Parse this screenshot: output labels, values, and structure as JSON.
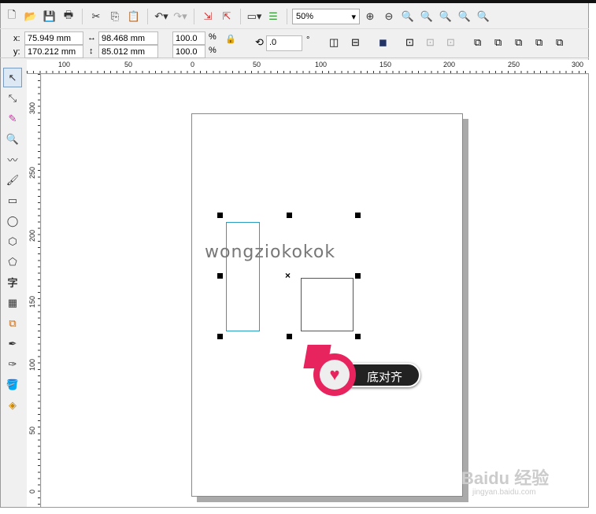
{
  "toolbar": {
    "icons": [
      "new-icon",
      "open-icon",
      "save-icon",
      "print-icon",
      "cut-icon",
      "copy-icon",
      "paste-icon",
      "undo-icon",
      "redo-icon",
      "import-icon",
      "export-icon",
      "publish-icon",
      "options-icon"
    ],
    "zoom_value": "50%",
    "zoom_icons": [
      "zoom-in-icon",
      "zoom-out-icon",
      "zoom-selected-icon",
      "zoom-all-icon",
      "zoom-page-icon",
      "zoom-width-icon",
      "zoom-height-icon"
    ]
  },
  "property_bar": {
    "x_label": "x:",
    "x_value": "75.949 mm",
    "y_label": "y:",
    "y_value": "170.212 mm",
    "width_value": "98.468 mm",
    "height_value": "85.012 mm",
    "scale_x": "100.0",
    "scale_y": "100.0",
    "percent": "%",
    "rotation": ".0",
    "degree": "°"
  },
  "ruler": {
    "h_labels": [
      "100",
      "50",
      "0",
      "50",
      "100",
      "150",
      "200",
      "250",
      "300"
    ],
    "v_labels": [
      "300",
      "250",
      "200",
      "150",
      "100",
      "50",
      "0"
    ]
  },
  "canvas": {
    "logo_text": "wongziokokok",
    "callout_label": "底对齐"
  },
  "watermark": {
    "brand": "Baidu 经验",
    "url": "jingyan.baidu.com"
  }
}
